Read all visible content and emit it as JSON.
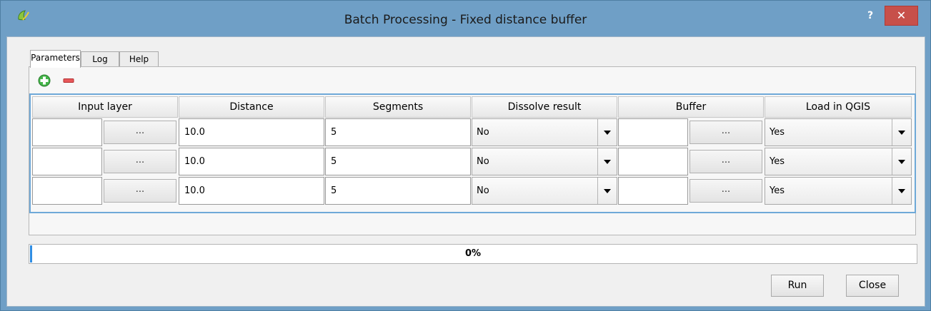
{
  "window": {
    "title": "Batch Processing - Fixed distance buffer",
    "help_label": "?",
    "close_label": "✕"
  },
  "tabs": [
    {
      "label": "Parameters",
      "active": true
    },
    {
      "label": "Log",
      "active": false
    },
    {
      "label": "Help",
      "active": false
    }
  ],
  "toolbar": {
    "add_icon": "plus-icon",
    "remove_icon": "minus-icon"
  },
  "table": {
    "columns": [
      "Input layer",
      "Distance",
      "Segments",
      "Dissolve result",
      "Buffer",
      "Load in QGIS"
    ],
    "browse_label": "...",
    "rows": [
      {
        "input_layer": "",
        "distance": "10.0",
        "segments": "5",
        "dissolve": "No",
        "buffer": "",
        "load": "Yes"
      },
      {
        "input_layer": "",
        "distance": "10.0",
        "segments": "5",
        "dissolve": "No",
        "buffer": "",
        "load": "Yes"
      },
      {
        "input_layer": "",
        "distance": "10.0",
        "segments": "5",
        "dissolve": "No",
        "buffer": "",
        "load": "Yes"
      }
    ]
  },
  "progress": {
    "value": 0,
    "label": "0%"
  },
  "buttons": {
    "run": "Run",
    "close": "Close"
  },
  "colors": {
    "titlebar": "#6f9fc6",
    "close_button": "#c7504a",
    "table_focus_border": "#6fa9d8",
    "progress_fill": "#2f8de3"
  }
}
